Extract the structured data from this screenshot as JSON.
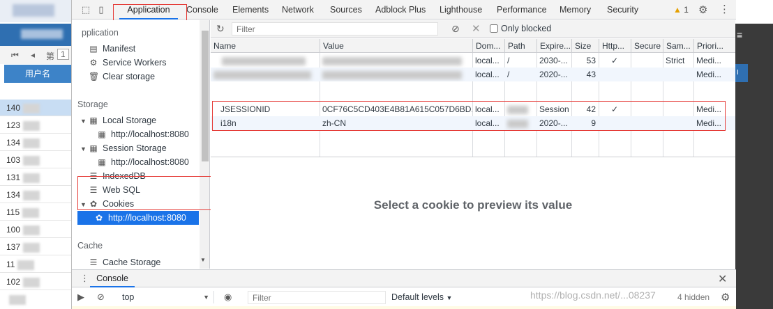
{
  "background_page": {
    "pager_label": "第",
    "pager_value": "1",
    "column_header": "用户名",
    "rows": [
      "140",
      "123",
      "134",
      "103",
      "131",
      "134",
      "115",
      "100",
      "137",
      "11",
      "102"
    ],
    "right_blue_label": "I"
  },
  "tabbar": {
    "tabs": [
      "Application",
      "Console",
      "Elements",
      "Network",
      "Sources",
      "Adblock Plus",
      "Lighthouse",
      "Performance",
      "Memory",
      "Security"
    ],
    "active_tab": "Application",
    "warnings_count": "1"
  },
  "sidebar": {
    "application_header": "pplication",
    "application_items": [
      "Manifest",
      "Service Workers",
      "Clear storage"
    ],
    "storage_header": "Storage",
    "local_storage": "Local Storage",
    "local_storage_child": "http://localhost:8080",
    "session_storage": "Session Storage",
    "session_storage_child": "http://localhost:8080",
    "indexeddb": "IndexedDB",
    "websql": "Web SQL",
    "cookies": "Cookies",
    "cookies_child": "http://localhost:8080",
    "cache_header": "Cache",
    "cache_storage": "Cache Storage"
  },
  "toolbar": {
    "filter_placeholder": "Filter",
    "only_blocked_label": "Only blocked"
  },
  "table": {
    "columns": [
      "Name",
      "Value",
      "Dom...",
      "Path",
      "Expire...",
      "Size",
      "Http...",
      "Secure",
      "Sam...",
      "Priori..."
    ],
    "rows": [
      {
        "name": "",
        "value": "",
        "domain": "local...",
        "path": "/",
        "expires": "2030-...",
        "size": "53",
        "httponly": "✓",
        "secure": "",
        "samesite": "Strict",
        "priority": "Medi..."
      },
      {
        "name": "",
        "value": "",
        "domain": "local...",
        "path": "/",
        "expires": "2020-...",
        "size": "43",
        "httponly": "",
        "secure": "",
        "samesite": "",
        "priority": "Medi..."
      },
      {
        "name": "JSESSIONID",
        "value": "0CF76C5CD403E4B81A615C057D6BD...",
        "domain": "local...",
        "path": "",
        "expires": "Session",
        "size": "42",
        "httponly": "✓",
        "secure": "",
        "samesite": "",
        "priority": "Medi..."
      },
      {
        "name": "i18n",
        "value": "zh-CN",
        "domain": "local...",
        "path": "",
        "expires": "2020-...",
        "size": "9",
        "httponly": "",
        "secure": "",
        "samesite": "",
        "priority": "Medi..."
      }
    ]
  },
  "preview_message": "Select a cookie to preview its value",
  "drawer": {
    "tab": "Console",
    "context": "top",
    "filter_placeholder": "Filter",
    "levels": "Default levels",
    "hidden": "4 hidden"
  },
  "watermark": "https://blog.csdn.net/...08237",
  "colors": {
    "accent": "#1a73e8",
    "annotation_red": "#e53935",
    "bg_blue": "#2f6fb1"
  }
}
